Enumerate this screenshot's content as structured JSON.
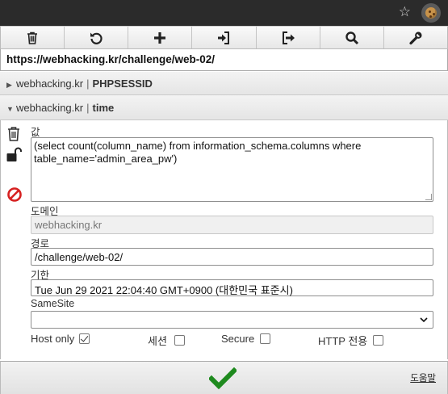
{
  "toolbar": {
    "buttons": [
      "trash-icon",
      "undo-icon",
      "plus-icon",
      "import-icon",
      "export-icon",
      "search-icon",
      "wrench-icon"
    ]
  },
  "url": "https://webhacking.kr/challenge/web-02/",
  "cookies": [
    {
      "domain": "webhacking.kr",
      "separator": "|",
      "name": "PHPSESSID",
      "expanded": false
    },
    {
      "domain": "webhacking.kr",
      "separator": "|",
      "name": "time",
      "expanded": true
    }
  ],
  "editor": {
    "value_label": "값",
    "value": "(select count(column_name) from information_schema.columns where table_name='admin_area_pw')",
    "domain_label": "도메인",
    "domain_value": "webhacking.kr",
    "path_label": "경로",
    "path_value": "/challenge/web-02/",
    "expiry_label": "기한",
    "expiry_value": "Tue Jun 29 2021 22:04:40 GMT+0900 (대한민국 표준시)",
    "samesite_label": "SameSite",
    "samesite_value": "",
    "flags": {
      "host_only_label": "Host only",
      "host_only": true,
      "session_label": "세션",
      "session": false,
      "secure_label": "Secure",
      "secure": false,
      "http_only_label": "HTTP 전용",
      "http_only": false
    }
  },
  "footer": {
    "help_label": "도움말"
  },
  "colors": {
    "ok_green": "#1e8a1e",
    "block_red": "#d62020",
    "toolbar_icon": "#222222"
  }
}
